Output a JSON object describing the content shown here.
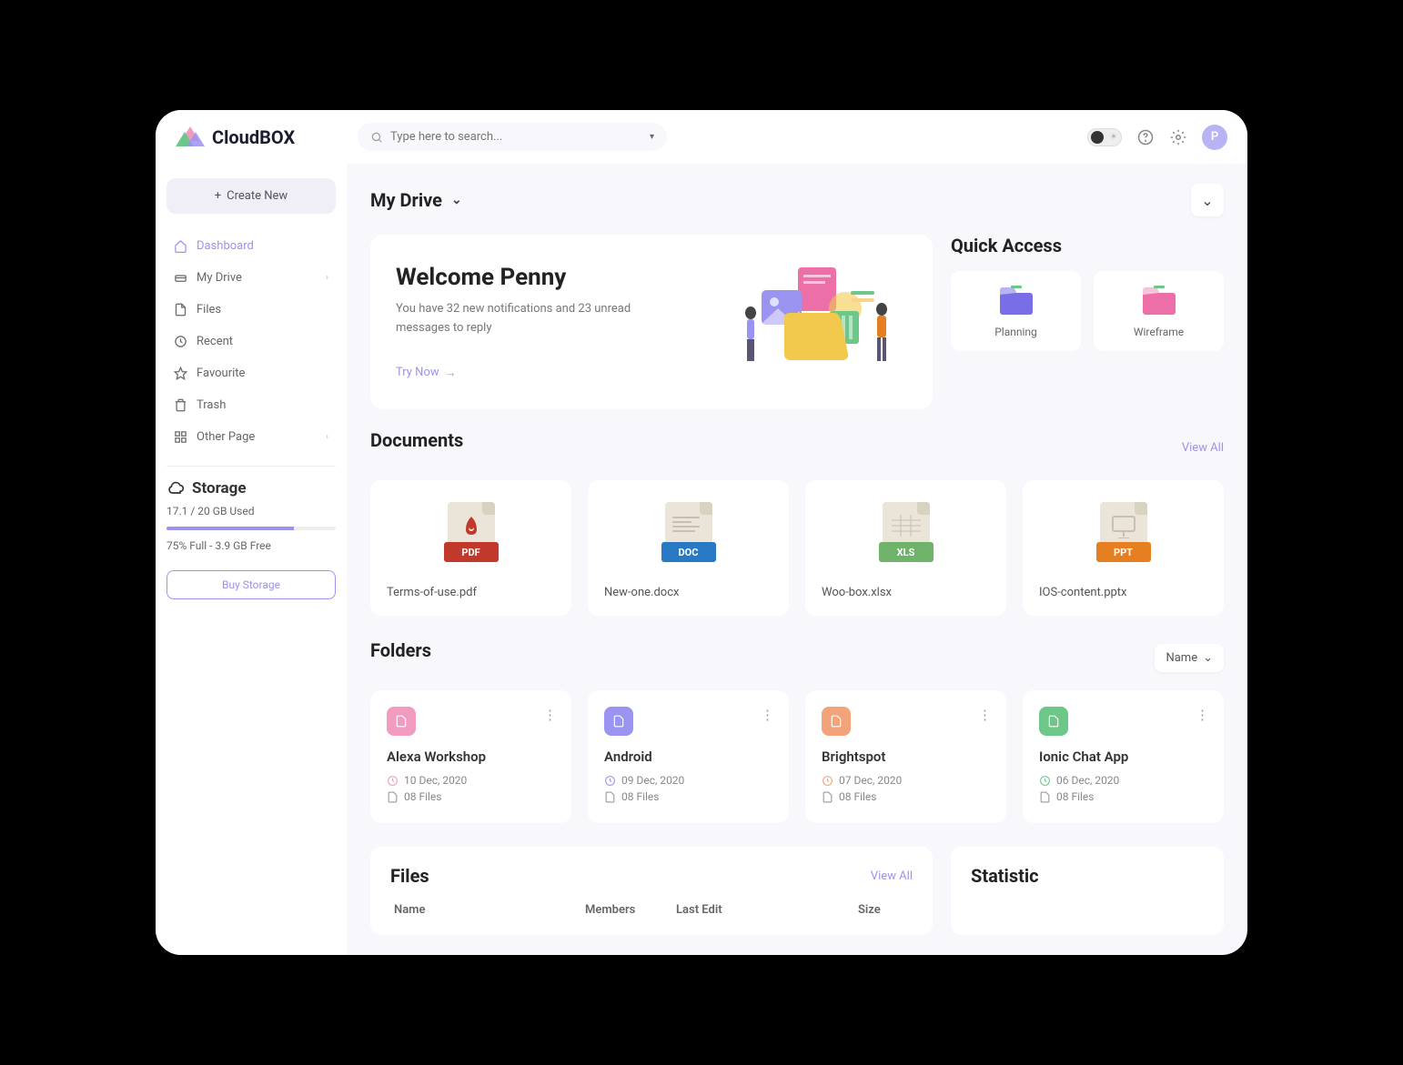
{
  "brand": "CloudBOX",
  "search": {
    "placeholder": "Type here to search..."
  },
  "avatar_letter": "P",
  "sidebar": {
    "create_label": "Create New",
    "items": [
      {
        "label": "Dashboard",
        "icon": "home",
        "active": true
      },
      {
        "label": "My Drive",
        "icon": "drive",
        "chevron": true
      },
      {
        "label": "Files",
        "icon": "file"
      },
      {
        "label": "Recent",
        "icon": "clock"
      },
      {
        "label": "Favourite",
        "icon": "star"
      },
      {
        "label": "Trash",
        "icon": "trash"
      },
      {
        "label": "Other Page",
        "icon": "grid",
        "chevron": true
      }
    ]
  },
  "storage": {
    "title": "Storage",
    "used": "17.1 / 20 GB Used",
    "detail": "75% Full - 3.9 GB Free",
    "percent": 75,
    "buy_label": "Buy Storage"
  },
  "page": {
    "title": "My Drive"
  },
  "welcome": {
    "title": "Welcome Penny",
    "subtitle": "You have 32 new notifications and 23 unread messages to reply",
    "cta": "Try Now"
  },
  "quick_access": {
    "title": "Quick Access",
    "items": [
      {
        "label": "Planning",
        "colors": [
          "#9b93f0",
          "#7a6ee8"
        ]
      },
      {
        "label": "Wireframe",
        "colors": [
          "#f29bc1",
          "#ec6fa8"
        ]
      }
    ]
  },
  "documents": {
    "title": "Documents",
    "view_all": "View All",
    "items": [
      {
        "name": "Terms-of-use.pdf",
        "badge": "PDF",
        "color": "#c0392b"
      },
      {
        "name": "New-one.docx",
        "badge": "DOC",
        "color": "#2779c4"
      },
      {
        "name": "Woo-box.xlsx",
        "badge": "XLS",
        "color": "#6fb36a"
      },
      {
        "name": "IOS-content.pptx",
        "badge": "PPT",
        "color": "#e67e22"
      }
    ]
  },
  "folders": {
    "title": "Folders",
    "sort_label": "Name",
    "items": [
      {
        "name": "Alexa Workshop",
        "date": "10 Dec, 2020",
        "files": "08 Files",
        "color": "#f29bc1"
      },
      {
        "name": "Android",
        "date": "09 Dec, 2020",
        "files": "08 Files",
        "color": "#9b93f0"
      },
      {
        "name": "Brightspot",
        "date": "07 Dec, 2020",
        "files": "08 Files",
        "color": "#f2a37a"
      },
      {
        "name": "Ionic Chat App",
        "date": "06 Dec, 2020",
        "files": "08 Files",
        "color": "#6dc789"
      }
    ]
  },
  "files": {
    "title": "Files",
    "view_all": "View All",
    "columns": {
      "name": "Name",
      "members": "Members",
      "last_edit": "Last Edit",
      "size": "Size"
    }
  },
  "statistic": {
    "title": "Statistic"
  }
}
